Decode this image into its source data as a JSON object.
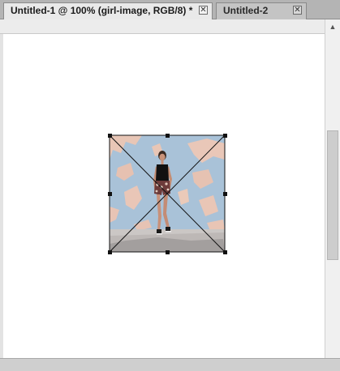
{
  "tabs": [
    {
      "label": "Untitled-1 @ 100% (girl-image, RGB/8) *",
      "close": "✕",
      "active": true
    },
    {
      "label": "Untitled-2",
      "close": "✕",
      "active": false
    }
  ],
  "scrollbar": {
    "up_arrow": "▲"
  },
  "layer": {
    "name": "girl-image"
  },
  "colors": {
    "wall_blue": "#9fbcd6",
    "wall_peach": "#e9c3b3",
    "ground": "#c9c5c2",
    "tab_active_bg": "#e9e9e9",
    "tabbar_bg": "#b4b4b4"
  },
  "icons": [
    "close-icon",
    "scroll-up-arrow-icon"
  ]
}
